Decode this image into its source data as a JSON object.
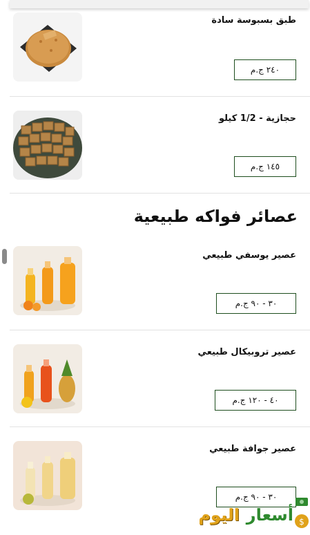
{
  "menu": {
    "items_top": [
      {
        "name": "طبق بسبوسة سادة",
        "price": "٢٤٠ ج.م"
      },
      {
        "name": "حجازية - 1/2 كيلو",
        "price": "١٤٥ ج.م"
      }
    ],
    "section_title": "عصائر فواكه طبيعية",
    "items_juice": [
      {
        "name": "عصير يوسفي طبيعي",
        "price": "٣٠ - ٩٠ ج.م"
      },
      {
        "name": "عصير تروبيكال طبيعي",
        "price": "٤٠ - ١٢٠ ج.م"
      },
      {
        "name": "عصير جوافة طبيعي",
        "price": "٣٠ - ٩٠ ج.م"
      }
    ]
  },
  "watermark": {
    "word1": "أسعار",
    "word2": "اليوم",
    "icon": "money-icon"
  },
  "colors": {
    "accent": "#1d4d1d",
    "divider": "#e2e2e2",
    "watermark_green": "#2f8a2f",
    "watermark_gold": "#e0a21a"
  }
}
